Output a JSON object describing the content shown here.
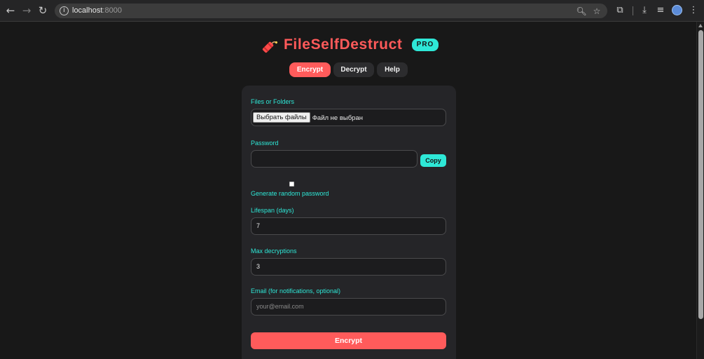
{
  "browser": {
    "url_host": "localhost",
    "url_port": ":8000",
    "icons": [
      "back-arrow-icon",
      "forward-arrow-icon",
      "reload-icon",
      "site-info-icon",
      "zoom-icon",
      "bookmark-star-icon",
      "extensions-icon",
      "download-icon",
      "media-controls-icon",
      "profile-avatar-icon",
      "kebab-menu-icon"
    ]
  },
  "app": {
    "brand_title": "FileSelfDestruct",
    "badge": "PRO",
    "brand_icon": "dynamite-icon",
    "colors": {
      "accent_red": "#ff5a5a",
      "accent_cyan": "#2ee8d7",
      "background": "#181818",
      "card": "#252528"
    }
  },
  "tabs": [
    {
      "label": "Encrypt",
      "active": true
    },
    {
      "label": "Decrypt",
      "active": false
    },
    {
      "label": "Help",
      "active": false
    }
  ],
  "form": {
    "files": {
      "label": "Files or Folders",
      "button_label": "Выбрать файлы",
      "status": "Файл не выбран"
    },
    "password": {
      "label": "Password",
      "value": "",
      "copy_label": "Copy"
    },
    "generate": {
      "label": "Generate random password",
      "checked": false
    },
    "lifespan": {
      "label": "Lifespan (days)",
      "value": "7"
    },
    "max_decryptions": {
      "label": "Max decryptions",
      "value": "3"
    },
    "email": {
      "label": "Email (for notifications, optional)",
      "placeholder": "your@email.com",
      "value": ""
    },
    "submit_label": "Encrypt"
  }
}
